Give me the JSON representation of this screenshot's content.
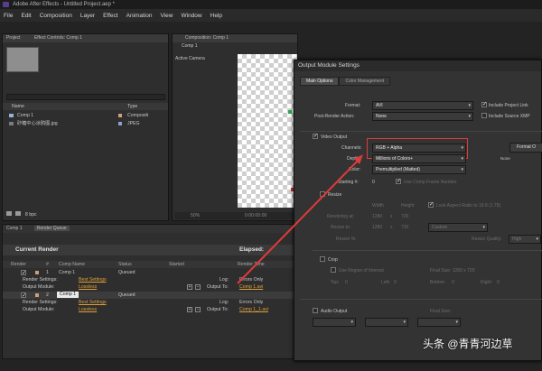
{
  "app": {
    "title": "Adobe After Effects - Untitled Project.aep *"
  },
  "menu": [
    "File",
    "Edit",
    "Composition",
    "Layer",
    "Effect",
    "Animation",
    "View",
    "Window",
    "Help"
  ],
  "project": {
    "tab": "Project",
    "tab2": "Effect Controls: Comp 1",
    "cols": {
      "name": "Name",
      "type": "Type"
    },
    "items": [
      {
        "name": "Comp 1",
        "type": "Compositi"
      },
      {
        "name": "砂糖中心涂鸦图.jpg",
        "type": "JPEG"
      }
    ],
    "bpc": "8 bpc"
  },
  "comp": {
    "tab": "Composition: Comp 1",
    "sub": "Comp 1",
    "camera": "Active Camera",
    "zoom": "50%",
    "time": "0:00:00:00"
  },
  "render": {
    "tabs": [
      "Comp 1",
      "Render Queue"
    ],
    "current": "Current Render",
    "elapsed": "Elapsed:",
    "cols": [
      "Render",
      "#",
      "Comp Name",
      "Status",
      "Started",
      "Render Time"
    ],
    "items": [
      {
        "num": "1",
        "name": "Comp 1",
        "status": "Queued",
        "rs_label": "Render Settings:",
        "rs": "Best Settings",
        "log_label": "Log:",
        "log": "Errors Only",
        "om_label": "Output Module:",
        "om": "Lossless",
        "out_label": "Output To:",
        "out": "Comp 1.avi"
      },
      {
        "num": "2",
        "name": "Comp 1",
        "status": "Queued",
        "rs_label": "Render Settings:",
        "rs": "Best Settings",
        "log_label": "Log:",
        "log": "Errors Only",
        "om_label": "Output Module:",
        "om": "Lossless",
        "out_label": "Output To:",
        "out": "Comp 1_1.avi"
      }
    ]
  },
  "dialog": {
    "title": "Output Module Settings",
    "tabs": [
      "Main Options",
      "Color Management"
    ],
    "format_label": "Format:",
    "format": "AVI",
    "include_link": "Include Project Link",
    "post_label": "Post-Render Action:",
    "post": "None",
    "include_xmp": "Include Source XMP",
    "video_output": "Video Output",
    "channels_label": "Channels:",
    "channels": "RGB + Alpha",
    "format_options": "Format O",
    "depth_label": "Depth:",
    "depth": "Millions of Colors+",
    "depth_note": "None",
    "color_label": "Color:",
    "color": "Premultiplied (Matted)",
    "starting_label": "Starting #:",
    "starting": "0",
    "use_comp_frame": "Use Comp Frame Number",
    "resize": "Resize",
    "width": "Width",
    "height": "Height",
    "lock_aspect": "Lock Aspect Ratio to 16:9 (1.78)",
    "rendering_at": "Rendering at:",
    "resize_to": "Resize to:",
    "resize_pct": "Resize %:",
    "rw": "1280",
    "rh": "720",
    "custom": "Custom",
    "resize_quality": "Resize Quality:",
    "quality": "High",
    "crop": "Crop",
    "use_roi": "Use Region of Interest",
    "final_size": "Final Size: 1280 x 720",
    "top": "Top:",
    "left": "Left:",
    "bottom": "Bottom:",
    "right": "Right:",
    "zero": "0",
    "audio_output": "Audio Output",
    "final_size2": "Final Size:"
  },
  "watermark": "头条 @青青河边草"
}
